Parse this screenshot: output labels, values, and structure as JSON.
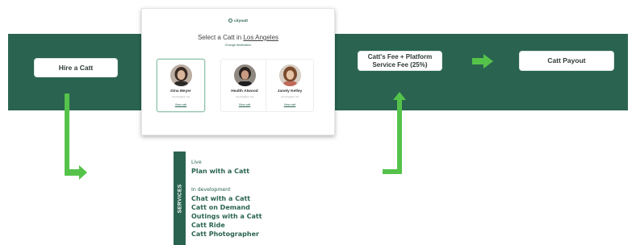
{
  "flow": {
    "hire_label": "Hire a Catt",
    "fee_label_line1": "Catt's Fee + Platform",
    "fee_label_line2": "Service Fee (25%)",
    "payout_label": "Catt Payout"
  },
  "modal": {
    "logo": "cityoatt",
    "title_prefix": "Select a Catt in",
    "city": "Los Angeles",
    "change_destination": "Change destination",
    "cards": [
      {
        "name": "Dina Meyer",
        "location": "Los Angeles, CA",
        "link": "View catt"
      },
      {
        "name": "Health Atwood",
        "location": "Los Angeles, CA",
        "link": "View catt"
      },
      {
        "name": "Janely Kelley",
        "location": "Los Angeles, CA",
        "link": "View catt"
      }
    ]
  },
  "services": {
    "label": "SERVICES",
    "live_heading": "Live",
    "live_items": [
      "Plan with a Catt"
    ],
    "dev_heading": "In development",
    "dev_items": [
      "Chat with a Catt",
      "Catt on Demand",
      "Outings with a Catt",
      "Catt Ride",
      "Catt Photographer"
    ]
  },
  "colors": {
    "band": "#2a6450",
    "arrow": "#55c34a",
    "box_bg": "#ffffff"
  }
}
